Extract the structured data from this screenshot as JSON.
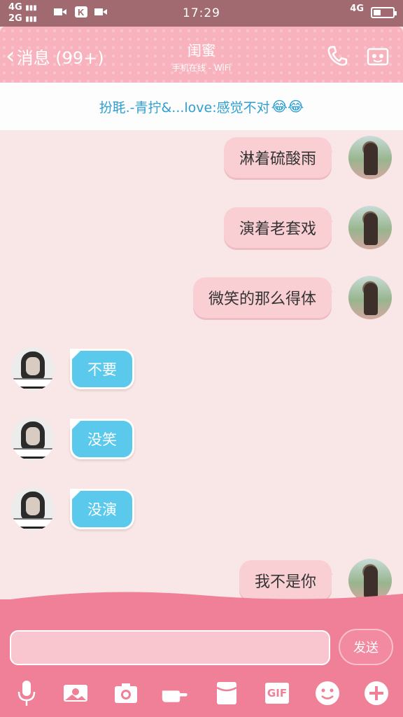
{
  "status_bar": {
    "network_line1": "4G",
    "network_line2": "2G",
    "time": "17:29",
    "right_network": "4G"
  },
  "header": {
    "back_label": "消息 (99+)",
    "title": "闺蜜",
    "subtitle": "手机在线 - WiFi"
  },
  "banner": {
    "text": "扮毦.-青拧&...love:感觉不对",
    "emoji": "😂😂"
  },
  "messages": [
    {
      "sender": "me",
      "text": "淋着硫酸雨"
    },
    {
      "sender": "me",
      "text": "演着老套戏"
    },
    {
      "sender": "me",
      "text": "微笑的那么得体"
    },
    {
      "sender": "friend",
      "text": "不要"
    },
    {
      "sender": "friend",
      "text": "没笑"
    },
    {
      "sender": "friend",
      "text": "没演"
    },
    {
      "sender": "me",
      "text": "我不是你"
    }
  ],
  "composer": {
    "send_label": "发送",
    "gif_label": "GIF"
  },
  "colors": {
    "status_bar": "#a06a70",
    "header_pink": "#f7b2bd",
    "my_bubble": "#f9cfd4",
    "friend_bubble": "#5bc9ec",
    "bottom_bar": "#ef8098"
  }
}
